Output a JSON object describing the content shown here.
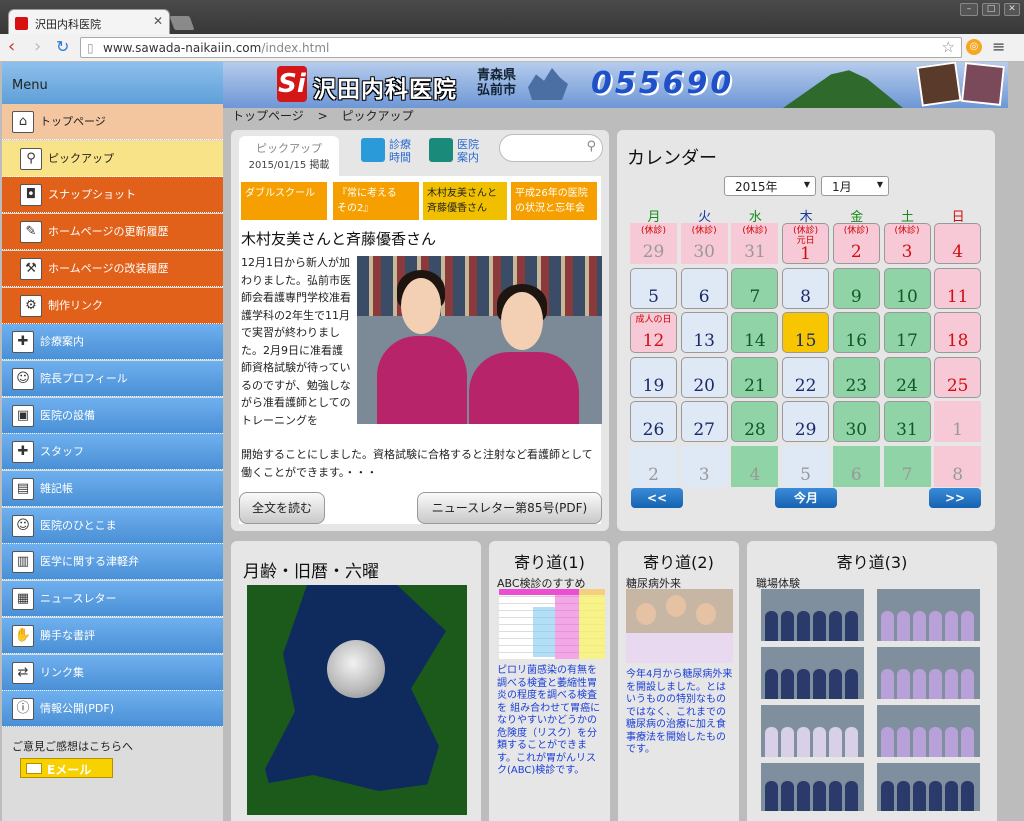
{
  "browser": {
    "tab_title": "沢田内科医院",
    "url_host": "www.sawada-naikaiin.com",
    "url_path": "/index.html"
  },
  "sidebar": {
    "title": "Menu",
    "items": [
      {
        "label": "トップページ",
        "icon": "house-icon"
      },
      {
        "label": "ピックアップ",
        "icon": "magnifier-icon"
      },
      {
        "label": "スナップショット",
        "icon": "camera-icon"
      },
      {
        "label": "ホームページの更新履歴",
        "icon": "brush-icon"
      },
      {
        "label": "ホームページの改装履歴",
        "icon": "hammer-icon"
      },
      {
        "label": "制作リンク",
        "icon": "gear-icon"
      },
      {
        "label": "診療案内",
        "icon": "hospital-icon"
      },
      {
        "label": "院長プロフィール",
        "icon": "doctor-icon"
      },
      {
        "label": "医院の設備",
        "icon": "equipment-icon"
      },
      {
        "label": "スタッフ",
        "icon": "nurse-cap-icon"
      },
      {
        "label": "雑記帳",
        "icon": "notebook-icon"
      },
      {
        "label": "医院のひとこま",
        "icon": "person-icon"
      },
      {
        "label": "医学に関する津軽弁",
        "icon": "book-icon"
      },
      {
        "label": "ニュースレター",
        "icon": "newsletter-icon"
      },
      {
        "label": "勝手な書評",
        "icon": "hand-icon"
      },
      {
        "label": "リンク集",
        "icon": "handshake-icon"
      },
      {
        "label": "情報公開(PDF)",
        "icon": "info-icon"
      }
    ],
    "feedback": "ご意見ご感想はこちらへ",
    "email_button": "Eメール"
  },
  "header": {
    "logo_mark": "Si",
    "clinic_name": "沢田内科医院",
    "prefecture": "青森県",
    "city": "弘前市",
    "phone": "055690"
  },
  "breadcrumb": {
    "home": "トップページ",
    "sep": ">",
    "current": "ピックアップ"
  },
  "pickup": {
    "tab_label": "ピックアップ",
    "tab_date": "2015/01/15 掲載",
    "quick_links": [
      {
        "line1": "診療",
        "line2": "時間"
      },
      {
        "line1": "医院",
        "line2": "案内"
      }
    ],
    "other_topics": [
      "ダブルスクール",
      "『常に考える　その2』",
      "木村友美さんと斉藤優香さん",
      "平成26年の医院の状況と忘年会"
    ],
    "article_title": "木村友美さんと斉藤優香さん",
    "article_body": "12月1日から新人が加わりました。弘前市医師会看護専門学校准看護学科の2年生で11月で実習が終わりました。2月9日に准看護師資格試験が待っているのですが、勉強しながら准看護師としてのトレーニングを",
    "article_tail": "開始することにしました。資格試験に合格すると注射など看護師として働くことができます。・・・",
    "read_more": "全文を読む",
    "newsletter_button": "ニュースレター第85号(PDF)"
  },
  "calendar": {
    "title": "カレンダー",
    "year": "2015年",
    "month": "1月",
    "weekdays": [
      "月",
      "火",
      "水",
      "木",
      "金",
      "土",
      "日"
    ],
    "weekday_colors": [
      "#1a8a1a",
      "#1a3a9a",
      "#1a8a1a",
      "#1a3a9a",
      "#1a8a1a",
      "#1a8a1a",
      "#d01010"
    ],
    "weeks": [
      [
        {
          "d": "29",
          "note": "(休診)",
          "t": "holiday",
          "out": true
        },
        {
          "d": "30",
          "note": "(休診)",
          "t": "holiday",
          "out": true
        },
        {
          "d": "31",
          "note": "(休診)",
          "t": "holiday",
          "out": true
        },
        {
          "d": "1",
          "note": "(休診)\n元日",
          "t": "holiday"
        },
        {
          "d": "2",
          "note": "(休診)",
          "t": "holiday"
        },
        {
          "d": "3",
          "note": "(休診)",
          "t": "holiday"
        },
        {
          "d": "4",
          "t": "sunday"
        }
      ],
      [
        {
          "d": "5",
          "t": "normal"
        },
        {
          "d": "6",
          "t": "normal"
        },
        {
          "d": "7",
          "t": "half"
        },
        {
          "d": "8",
          "t": "normal"
        },
        {
          "d": "9",
          "t": "half"
        },
        {
          "d": "10",
          "t": "half"
        },
        {
          "d": "11",
          "t": "sunday"
        }
      ],
      [
        {
          "d": "12",
          "note": "成人の日",
          "t": "holiday"
        },
        {
          "d": "13",
          "t": "normal"
        },
        {
          "d": "14",
          "t": "half"
        },
        {
          "d": "15",
          "t": "today"
        },
        {
          "d": "16",
          "t": "half"
        },
        {
          "d": "17",
          "t": "half"
        },
        {
          "d": "18",
          "t": "sunday"
        }
      ],
      [
        {
          "d": "19",
          "t": "normal"
        },
        {
          "d": "20",
          "t": "normal"
        },
        {
          "d": "21",
          "t": "half"
        },
        {
          "d": "22",
          "t": "normal"
        },
        {
          "d": "23",
          "t": "half"
        },
        {
          "d": "24",
          "t": "half"
        },
        {
          "d": "25",
          "t": "sunday"
        }
      ],
      [
        {
          "d": "26",
          "t": "normal"
        },
        {
          "d": "27",
          "t": "normal"
        },
        {
          "d": "28",
          "t": "half"
        },
        {
          "d": "29",
          "t": "normal"
        },
        {
          "d": "30",
          "t": "half"
        },
        {
          "d": "31",
          "t": "half"
        },
        {
          "d": "1",
          "t": "sunday",
          "out": true
        }
      ],
      [
        {
          "d": "2",
          "t": "normal",
          "out": true
        },
        {
          "d": "3",
          "t": "normal",
          "out": true
        },
        {
          "d": "4",
          "t": "half",
          "out": true
        },
        {
          "d": "5",
          "t": "normal",
          "out": true
        },
        {
          "d": "6",
          "t": "half",
          "out": true
        },
        {
          "d": "7",
          "t": "half",
          "out": true
        },
        {
          "d": "8",
          "t": "sunday",
          "out": true
        }
      ]
    ],
    "prev": "<<",
    "today": "今月",
    "next": ">>",
    "colors": {
      "normal": "#dfe9f6",
      "half": "#8fd3a6",
      "holiday": "#f7c9d6",
      "sunday": "#f7c9d6",
      "today": "#f7c600"
    }
  },
  "moon": {
    "title": "月齢・旧暦・六曜"
  },
  "yorimichi1": {
    "title": "寄り道(1)",
    "subtitle": "ABC検診のすすめ",
    "text": "ピロリ菌感染の有無を調べる検査と萎縮性胃炎の程度を調べる検査を 組み合わせて胃癌になりやすいかどうかの危険度（リスク）を分類することができます。これが胃がんリスク(ABC)検診です。"
  },
  "yorimichi2": {
    "title": "寄り道(2)",
    "subtitle": "糖尿病外来",
    "text": "今年4月から糖尿病外来を開設しました。とはいうものの特別なものではなく、これまでの糖尿病の治療に加え食事療法を開始したものです。"
  },
  "yorimichi3": {
    "title": "寄り道(3)",
    "subtitle": "職場体験"
  }
}
